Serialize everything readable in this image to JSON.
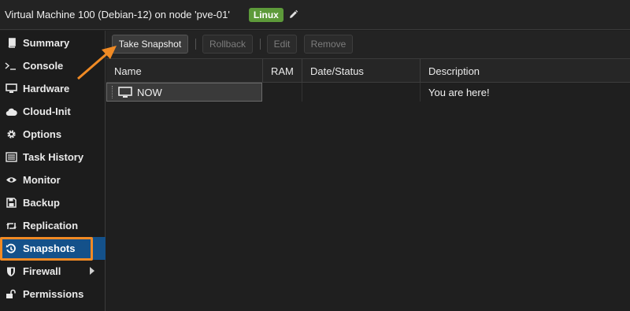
{
  "header": {
    "title": "Virtual Machine 100 (Debian-12) on node 'pve-01'",
    "tag": "Linux"
  },
  "sidebar": {
    "items": [
      {
        "label": "Summary",
        "icon": "book-icon"
      },
      {
        "label": "Console",
        "icon": "terminal-icon"
      },
      {
        "label": "Hardware",
        "icon": "monitor-icon"
      },
      {
        "label": "Cloud-Init",
        "icon": "cloud-icon"
      },
      {
        "label": "Options",
        "icon": "gear-icon"
      },
      {
        "label": "Task History",
        "icon": "list-icon"
      },
      {
        "label": "Monitor",
        "icon": "eye-icon"
      },
      {
        "label": "Backup",
        "icon": "floppy-icon"
      },
      {
        "label": "Replication",
        "icon": "retweet-icon"
      },
      {
        "label": "Snapshots",
        "icon": "history-icon",
        "active": true
      },
      {
        "label": "Firewall",
        "icon": "shield-icon",
        "has_submenu": true
      },
      {
        "label": "Permissions",
        "icon": "unlock-icon"
      }
    ]
  },
  "toolbar": {
    "take_snapshot": "Take Snapshot",
    "rollback": "Rollback",
    "edit": "Edit",
    "remove": "Remove"
  },
  "table": {
    "columns": [
      "Name",
      "RAM",
      "Date/Status",
      "Description"
    ],
    "rows": [
      {
        "name": "NOW",
        "ram": "",
        "date_status": "",
        "description": "You are here!"
      }
    ]
  },
  "colors": {
    "accent_highlight": "#f08a24",
    "active_nav": "#14518a",
    "tag_bg": "#5d9a3a"
  }
}
